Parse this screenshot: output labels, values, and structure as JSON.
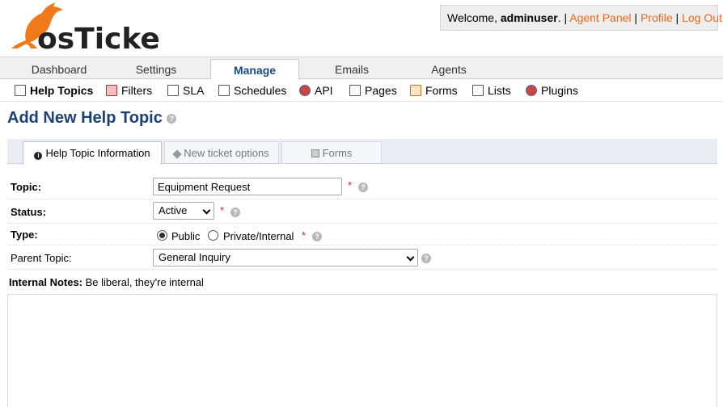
{
  "header": {
    "logo_text": "osTicket",
    "welcome_prefix": "Welcome, ",
    "username": "adminuser",
    "separator": ". |",
    "links": [
      "Agent Panel",
      "Profile",
      "Log Out"
    ],
    "pipe": "|"
  },
  "nav": {
    "tabs": [
      {
        "label": "Dashboard",
        "active": false
      },
      {
        "label": "Settings",
        "active": false
      },
      {
        "label": "Manage",
        "active": true
      },
      {
        "label": "Emails",
        "active": false
      },
      {
        "label": "Agents",
        "active": false
      }
    ]
  },
  "subnav": {
    "items": [
      {
        "label": "Help Topics",
        "icon": "help-topics-icon",
        "active": true
      },
      {
        "label": "Filters",
        "icon": "filters-icon",
        "active": false
      },
      {
        "label": "SLA",
        "icon": "sla-icon",
        "active": false
      },
      {
        "label": "Schedules",
        "icon": "schedules-icon",
        "active": false
      },
      {
        "label": "API",
        "icon": "api-icon",
        "active": false
      },
      {
        "label": "Pages",
        "icon": "pages-icon",
        "active": false
      },
      {
        "label": "Forms",
        "icon": "forms-icon",
        "active": false
      },
      {
        "label": "Lists",
        "icon": "lists-icon",
        "active": false
      },
      {
        "label": "Plugins",
        "icon": "plugins-icon",
        "active": false
      }
    ]
  },
  "page": {
    "title": "Add New Help Topic"
  },
  "form_tabs": [
    {
      "label": "Help Topic Information",
      "icon": "info-icon",
      "active": true
    },
    {
      "label": "New ticket options",
      "icon": "tag-icon",
      "active": false
    },
    {
      "label": "Forms",
      "icon": "copy-icon",
      "active": false
    }
  ],
  "form": {
    "topic_label": "Topic:",
    "topic_value": "Equipment Request",
    "status_label": "Status:",
    "status_value": "Active",
    "type_label": "Type:",
    "type_options": [
      "Public",
      "Private/Internal"
    ],
    "type_selected": "Public",
    "parent_label": "Parent Topic:",
    "parent_value": "General Inquiry",
    "required_mark": "*",
    "notes_label": "Internal Notes:",
    "notes_hint": "Be liberal, they're internal"
  },
  "colors": {
    "accent_orange": "#f06818",
    "title_blue": "#1c3f74",
    "required_red": "#e02020"
  }
}
